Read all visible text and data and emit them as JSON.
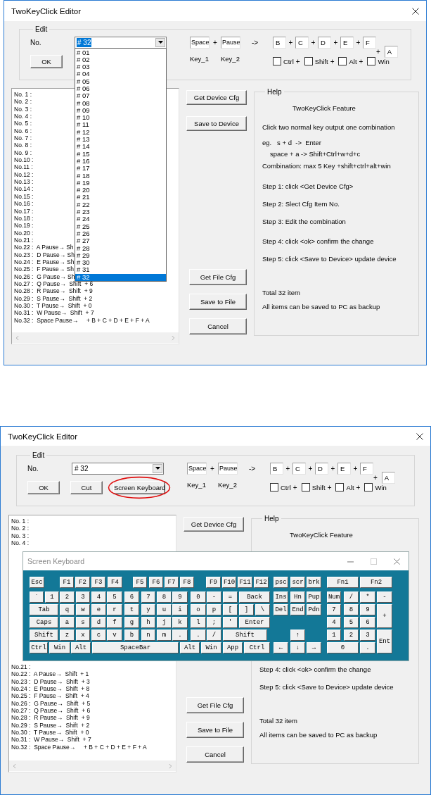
{
  "windows": [
    {
      "title": "TwoKeyClick Editor",
      "edit": {
        "legend": "Edit",
        "no_label": "No.",
        "combo": {
          "value": "# 32",
          "text_selected": true,
          "expanded": true,
          "items": [
            {
              "label": "# 01",
              "selected": false
            },
            {
              "label": "# 02",
              "selected": false
            },
            {
              "label": "# 03",
              "selected": false
            },
            {
              "label": "# 04",
              "selected": false
            },
            {
              "label": "# 05",
              "selected": false
            },
            {
              "label": "# 06",
              "selected": false
            },
            {
              "label": "# 07",
              "selected": false
            },
            {
              "label": "# 08",
              "selected": false
            },
            {
              "label": "# 09",
              "selected": false
            },
            {
              "label": "# 10",
              "selected": false
            },
            {
              "label": "# 11",
              "selected": false
            },
            {
              "label": "# 12",
              "selected": false
            },
            {
              "label": "# 13",
              "selected": false
            },
            {
              "label": "# 14",
              "selected": false
            },
            {
              "label": "# 15",
              "selected": false
            },
            {
              "label": "# 16",
              "selected": false
            },
            {
              "label": "# 17",
              "selected": false
            },
            {
              "label": "# 18",
              "selected": false
            },
            {
              "label": "# 19",
              "selected": false
            },
            {
              "label": "# 20",
              "selected": false
            },
            {
              "label": "# 21",
              "selected": false
            },
            {
              "label": "# 22",
              "selected": false
            },
            {
              "label": "# 23",
              "selected": false
            },
            {
              "label": "# 24",
              "selected": false
            },
            {
              "label": "# 25",
              "selected": false
            },
            {
              "label": "# 26",
              "selected": false
            },
            {
              "label": "# 27",
              "selected": false
            },
            {
              "label": "# 28",
              "selected": false
            },
            {
              "label": "# 29",
              "selected": false
            },
            {
              "label": "# 30",
              "selected": false
            },
            {
              "label": "# 31",
              "selected": false
            },
            {
              "label": "# 32",
              "selected": true
            }
          ]
        },
        "buttons": [
          {
            "label": "OK",
            "circled": false
          }
        ],
        "keys": [
          {
            "value": "Space",
            "caption": "Key_1"
          },
          {
            "value": "Pause",
            "caption": "Key_2"
          }
        ],
        "key_joiner": "+",
        "arrow": "->",
        "results": [
          {
            "value": "B",
            "sep": "+"
          },
          {
            "value": "C",
            "sep": "+"
          },
          {
            "value": "D",
            "sep": "+"
          },
          {
            "value": "E",
            "sep": "+"
          },
          {
            "value": "F"
          }
        ],
        "extra": {
          "sep": "+",
          "value": "A"
        },
        "checkboxes": [
          {
            "label": "Ctrl",
            "checked": false,
            "sep": "+"
          },
          {
            "label": "Shift",
            "checked": false,
            "sep": "+"
          },
          {
            "label": "Alt",
            "checked": false,
            "sep": "+"
          },
          {
            "label": "Win",
            "checked": false
          }
        ]
      },
      "list": {
        "rows": [
          "No. 1 :",
          "No. 2 :",
          "No. 3 :",
          "No. 4 :",
          "No. 5 :",
          "No. 6 :",
          "No. 7 :",
          "No. 8 :",
          "No. 9 :",
          "No.10 :",
          "No.11 :",
          "No.12 :",
          "No.13 :",
          "No.14 :",
          "No.15 :",
          "No.16 :",
          "No.17 :",
          "No.18 :",
          "No.19 :",
          "No.20 :",
          "No.21 :",
          "No.22 :  A Pause→ Sh",
          "No.23 :  D Pause→ Sh",
          "No.24 :  E Pause→ Sh",
          "No.25 :  F Pause→ Sh",
          "No.26 :  G Pause→ Sh",
          "No.27 :  Q Pause→  Shift  + 6",
          "No.28 :  R Pause→  Shift  + 9",
          "No.29 :  S Pause→  Shift  + 2",
          "No.30 :  T Pause→  Shift  + 0",
          "No.31 :  W Pause→  Shift  + 7",
          "No.32 :  Space Pause→     + B + C + D + E + F + A"
        ]
      },
      "device_buttons": [
        "Get Device Cfg",
        "Save to Device"
      ],
      "file_buttons": [
        "Get File Cfg",
        "Save to File",
        "Cancel"
      ],
      "help": {
        "label": "Help",
        "lines": [
          {
            "kind": "title",
            "text": "TwoKeyClick Feature"
          },
          {
            "kind": "lead",
            "text": "Click two normal key output one combination"
          },
          {
            "kind": "example",
            "text": "eg.   s + d  ->  Enter"
          },
          {
            "kind": "detail",
            "text": "space + a -> Shift+Ctrl+w+d+c"
          },
          {
            "kind": "rule",
            "text": "Combination: max 5 Key +shift+ctrl+alt+win"
          },
          {
            "kind": "first-step",
            "text": "Step 1: click <Get Device Cfg>"
          },
          {
            "kind": "step",
            "text": "Step 2: Slect Cfg Item No."
          },
          {
            "kind": "step",
            "text": "Step 3: Edit the combination"
          }
        ],
        "lines_end": [
          {
            "kind": "step",
            "text": "Step 4: click <ok> confirm the change"
          },
          {
            "kind": "step",
            "text": "Step 5: click <Save to Device> update device"
          },
          {
            "kind": "summary",
            "text": "Total 32 item"
          },
          {
            "kind": "note",
            "text": "All items can be saved to PC as backup"
          }
        ]
      }
    },
    {
      "title": "TwoKeyClick Editor",
      "edit": {
        "legend": "Edit",
        "no_label": "No.",
        "combo": {
          "value": "# 32",
          "text_selected": false,
          "expanded": false
        },
        "buttons": [
          {
            "label": "OK",
            "circled": false
          },
          {
            "label": "Cut",
            "circled": false
          },
          {
            "label": "Screen Keyboard",
            "circled": true
          }
        ],
        "keys": [
          {
            "value": "Space",
            "caption": "Key_1"
          },
          {
            "value": "Pause",
            "caption": "Key_2"
          }
        ],
        "key_joiner": "+",
        "arrow": "->",
        "results": [
          {
            "value": "B",
            "sep": "+"
          },
          {
            "value": "C",
            "sep": "+"
          },
          {
            "value": "D",
            "sep": "+"
          },
          {
            "value": "E",
            "sep": "+"
          },
          {
            "value": "F"
          }
        ],
        "extra": {
          "sep": "+",
          "value": "A"
        },
        "checkboxes": [
          {
            "label": "Ctrl",
            "checked": false,
            "sep": "+"
          },
          {
            "label": "Shift",
            "checked": false,
            "sep": "+"
          },
          {
            "label": "Alt",
            "checked": false,
            "sep": "+"
          },
          {
            "label": "Win",
            "checked": false
          }
        ]
      },
      "list": {
        "rows": [
          "No. 1 :",
          "No. 2 :",
          "No. 3 :",
          "No. 4 :"
        ],
        "rows_end": [
          "No.21 :",
          "No.22 :  A Pause→  Shift  + 1",
          "No.23 :  D Pause→  Shift  + 3",
          "No.24 :  E Pause→  Shift  + 8",
          "No.25 :  F Pause→  Shift  + 4",
          "No.26 :  G Pause→  Shift  + 5",
          "No.27 :  Q Pause→  Shift  + 6",
          "No.28 :  R Pause→  Shift  + 9",
          "No.29 :  S Pause→  Shift  + 2",
          "No.30 :  T Pause→  Shift  + 0",
          "No.31 :  W Pause→  Shift  + 7",
          "No.32 :  Space Pause→     + B + C + D + E + F + A"
        ]
      },
      "device_buttons": [
        "Get Device Cfg"
      ],
      "file_buttons": [
        "Get File Cfg",
        "Save to File",
        "Cancel"
      ],
      "help": {
        "label": "Help",
        "lines": [
          {
            "kind": "title",
            "text": "TwoKeyClick Feature"
          }
        ],
        "lines_end": [
          {
            "kind": "step",
            "text": "Step 4: click <ok> confirm the change"
          },
          {
            "kind": "step",
            "text": "Step 5: click <Save to Device> update device"
          },
          {
            "kind": "summary",
            "text": "Total 32 item"
          },
          {
            "kind": "note",
            "text": "All items can be saved to PC as backup"
          }
        ]
      },
      "keyboard": {
        "title": "Screen Keyboard",
        "keys": [
          "Esc",
          "F1",
          "F2",
          "F3",
          "F4",
          "F5",
          "F6",
          "F7",
          "F8",
          "F9",
          "F10",
          "F11",
          "F12",
          "psc",
          "scr",
          "brk",
          "Fn1",
          "Fn2",
          "`",
          "1",
          "2",
          "3",
          "4",
          "5",
          "6",
          "7",
          "8",
          "9",
          "0",
          "-",
          "=",
          "Back",
          "Ins",
          "Hn",
          "Pup",
          "Num",
          "/",
          "*",
          "-",
          "Tab",
          "q",
          "w",
          "e",
          "r",
          "t",
          "y",
          "u",
          "i",
          "o",
          "p",
          "[",
          "]",
          "\\",
          "Del",
          "End",
          "Pdn",
          "7",
          "8",
          "9",
          "+",
          "Caps",
          "a",
          "s",
          "d",
          "f",
          "g",
          "h",
          "j",
          "k",
          "l",
          ";",
          "'",
          "Enter",
          "4",
          "5",
          "6",
          "Shift",
          "z",
          "x",
          "c",
          "v",
          "b",
          "n",
          "m",
          ".",
          ".",
          "/",
          "Shift",
          "↑",
          "1",
          "2",
          "3",
          "Ent",
          "Ctrl",
          "Win",
          "Alt",
          "SpaceBar",
          "Alt",
          "Win",
          "App",
          "Ctrl",
          "←",
          "↓",
          "→",
          "0",
          "."
        ]
      }
    }
  ]
}
